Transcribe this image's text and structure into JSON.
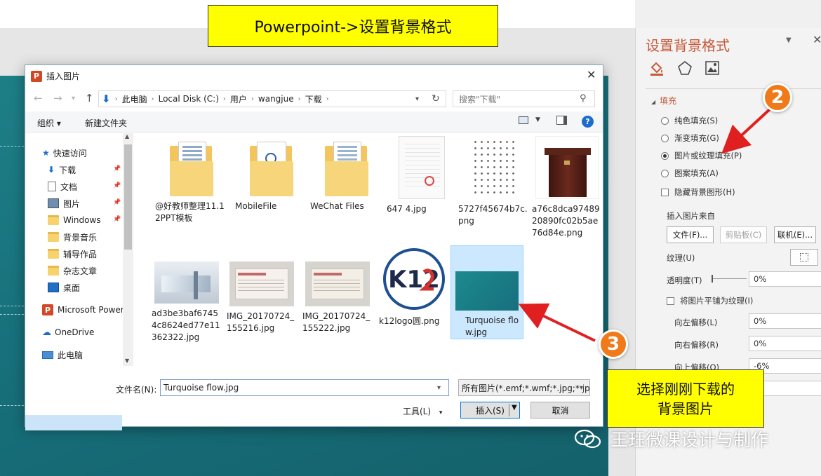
{
  "callouts": {
    "top": "Powerpoint->设置背景格式",
    "bottom_line1": "选择刚刚下载的",
    "bottom_line2": "背景图片",
    "badge2": "2",
    "badge3": "3"
  },
  "watermark": "王珏微课设计与制作",
  "pane": {
    "title": "设置背景格式",
    "section": "填充",
    "options": [
      "纯色填充(S)",
      "渐变填充(G)",
      "图片或纹理填充(P)",
      "图案填充(A)"
    ],
    "selected_option": "图片或纹理填充(P)",
    "hide_bg": "隐藏背景图形(H)",
    "insert_from": "插入图片来自",
    "btn_file": "文件(F)...",
    "btn_clipboard": "剪贴板(C)",
    "btn_online": "联机(E)...",
    "texture": "纹理(U)",
    "transparency_label": "透明度(T)",
    "transparency_value": "0%",
    "tile": "将图片平铺为纹理(I)",
    "offset_left_label": "向左偏移(L)",
    "offset_left_value": "0%",
    "offset_right_label": "向右偏移(R)",
    "offset_right_value": "0%",
    "offset_top_label": "向上偏移(O)",
    "offset_top_value": "-6%",
    "offset_bottom_value": "%"
  },
  "dialog": {
    "title": "插入图片",
    "breadcrumb": [
      "此电脑",
      "Local Disk (C:)",
      "用户",
      "wangjue",
      "下载"
    ],
    "search_placeholder": "搜索\"下载\"",
    "organize": "组织 ▾",
    "new_folder": "新建文件夹",
    "tree": {
      "quick_access": "快速访问",
      "downloads": "下载",
      "documents": "文档",
      "pictures": "图片",
      "windows": "Windows",
      "bg_music": "背景音乐",
      "tutoring": "辅导作品",
      "magazine": "杂志文章",
      "desktop": "桌面",
      "ms_ppt": "Microsoft Power",
      "onedrive": "OneDrive",
      "this_pc": "此电脑"
    },
    "files": [
      {
        "name": "@好教师整理11.12PPT模板",
        "kind": "folder"
      },
      {
        "name": "MobileFile",
        "kind": "folder"
      },
      {
        "name": "WeChat Files",
        "kind": "folder"
      },
      {
        "name": "647 4.jpg",
        "kind": "doc"
      },
      {
        "name": "5727f45674b7c.png",
        "kind": "clipart"
      },
      {
        "name": "a76c8dca9748920890fc02b5ae76d84e.png",
        "kind": "podium"
      },
      {
        "name": "ad3be3baf67454c8624ed77e11362322.jpg",
        "kind": "building"
      },
      {
        "name": "IMG_20170724_155216.jpg",
        "kind": "ticket"
      },
      {
        "name": "IMG_20170724_155222.jpg",
        "kind": "ticket"
      },
      {
        "name": "k12logo圆.png",
        "kind": "logo"
      },
      {
        "name": "Turquoise flow.jpg",
        "kind": "teal"
      }
    ],
    "logo_text": "K12",
    "filename_label": "文件名(N):",
    "filename_value": "Turquoise flow.jpg",
    "filetype_value": "所有图片(*.emf;*.wmf;*.jpg;*.jp",
    "tools": "工具(L)",
    "insert": "插入(S)",
    "cancel": "取消"
  },
  "colors": {
    "slide": "#17707b",
    "accent_title": "#c55a3b",
    "callout_bg": "#ffff00",
    "badge": "#f07a1a",
    "arrow": "#e02020"
  }
}
